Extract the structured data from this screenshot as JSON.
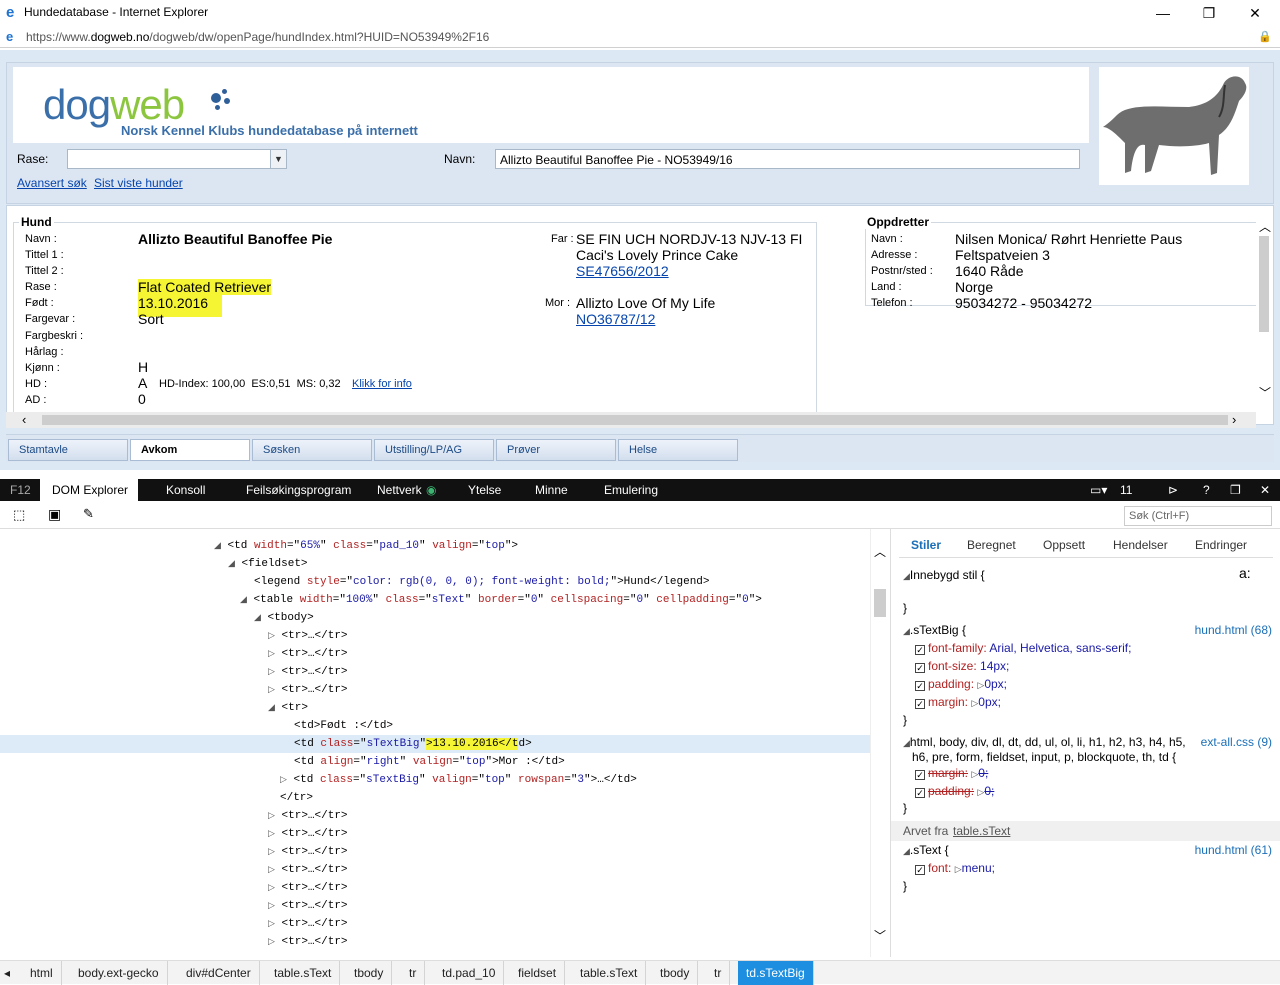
{
  "window": {
    "title": "Hundedatabase - Internet Explorer",
    "url_prefix": "https://www.",
    "url_domain": "dogweb.no",
    "url_rest": "/dogweb/dw/openPage/hundIndex.html?HUID=NO53949%2F16"
  },
  "site": {
    "logo_dog": "dog",
    "logo_web": "web",
    "subtitle": "Norsk Kennel Klubs hundedatabase på internett",
    "rase_label": "Rase:",
    "navn_label": "Navn:",
    "navn_value": "Allizto Beautiful Banoffee Pie - NO53949/16",
    "link_advanced": "Avansert søk",
    "link_last": "Sist viste hunder"
  },
  "hund": {
    "legend": "Hund",
    "labels": [
      "Navn :",
      "Tittel 1 :",
      "Tittel 2 :",
      "Rase :",
      "Født :",
      "Fargevar :",
      "Fargbeskri :",
      "Hårlag :",
      "Kjønn :",
      "HD :",
      "AD :"
    ],
    "navn": "Allizto Beautiful Banoffee Pie",
    "rase": "Flat Coated Retriever",
    "fodt": "13.10.2016",
    "fargevar": "Sort",
    "kjonn": "H",
    "hd": "A",
    "hd_extra": "HD-Index: 100,00  ES:0,51  MS: 0,32",
    "hd_link": "Klikk for info",
    "ad": "0",
    "far_label": "Far :",
    "far_line1": "SE FIN UCH NORDJV-13 NJV-13 FI",
    "far_line2": "Caci's Lovely Prince Cake",
    "far_reg": "SE47656/2012",
    "mor_label": "Mor :",
    "mor_name": "Allizto Love Of My Life",
    "mor_reg": "NO36787/12"
  },
  "oppdretter": {
    "legend": "Oppdretter",
    "labels": [
      "Navn :",
      "Adresse :",
      "Postnr/sted :",
      "Land :",
      "Telefon :"
    ],
    "values": [
      "Nilsen Monica/ Røhrt Henriette Paus",
      "Feltspatveien 3",
      "1640 Råde",
      "Norge",
      "95034272 - 95034272"
    ]
  },
  "tabs": [
    "Stamtavle",
    "Avkom",
    "Søsken",
    "Utstilling/LP/AG",
    "Prøver",
    "Helse"
  ],
  "devtools": {
    "f12": "F12",
    "tabs": [
      "DOM Explorer",
      "Konsoll",
      "Feilsøkingsprogram",
      "Nettverk",
      "Ytelse",
      "Minne",
      "Emulering"
    ],
    "doc_mode": "11",
    "search_placeholder": "Søk (Ctrl+F)",
    "style_tabs": [
      "Stiler",
      "Beregnet",
      "Oppsett",
      "Hendelser",
      "Endringer"
    ],
    "inline_style": "Innebygd stil  {",
    "close": "}",
    "rule1_sel": ".sTextBig  {",
    "rule1_src": "hund.html (68)",
    "rule1_props": [
      [
        "font-family:",
        "Arial, Helvetica, sans-serif;"
      ],
      [
        "font-size:",
        "14px;"
      ],
      [
        "padding:",
        "0px;"
      ],
      [
        "margin:",
        "0px;"
      ]
    ],
    "rule2_sel1": "html, body, div, dl, dt, dd, ul, ol, li, h1, h2, h3, h4, h5,",
    "rule2_sel2": "h6, pre, form, fieldset, input, p, blockquote, th, td  {",
    "rule2_src": "ext-all.css (9)",
    "rule2_props": [
      [
        "margin:",
        "0;"
      ],
      [
        "padding:",
        "0;"
      ]
    ],
    "inherited": "Arvet fra ",
    "inherited_link": "table.sText",
    "rule3_sel": ".sText  {",
    "rule3_src": "hund.html (61)",
    "rule3_prop": "font:",
    "rule3_val": "menu;",
    "breadcrumbs": [
      "html",
      "body.ext-gecko",
      "div#dCenter",
      "table.sText",
      "tbody",
      "tr",
      "td.pad_10",
      "fieldset",
      "table.sText",
      "tbody",
      "tr",
      "td.sTextBig"
    ]
  }
}
